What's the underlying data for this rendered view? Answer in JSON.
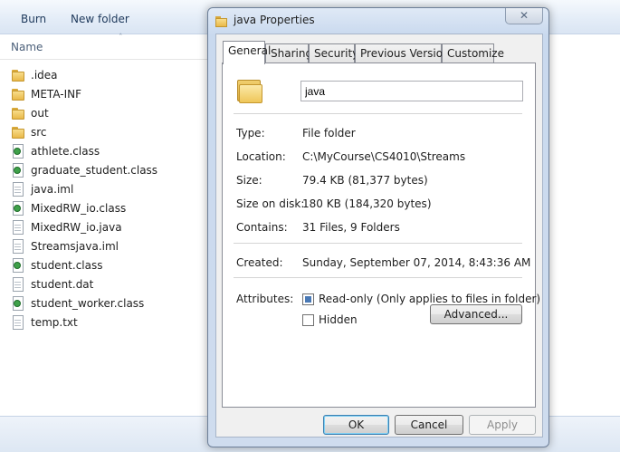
{
  "explorer": {
    "toolbar": {
      "burn_label": "Burn",
      "new_folder_label": "New folder"
    },
    "column_header": {
      "name_label": "Name",
      "sort_glyph": "ˆ"
    },
    "files": [
      {
        "name": ".idea",
        "icon": "folder-icon"
      },
      {
        "name": "META-INF",
        "icon": "folder-icon"
      },
      {
        "name": "out",
        "icon": "folder-icon"
      },
      {
        "name": "src",
        "icon": "folder-icon"
      },
      {
        "name": "athlete.class",
        "icon": "class-file-icon"
      },
      {
        "name": "graduate_student.class",
        "icon": "class-file-icon"
      },
      {
        "name": "java.iml",
        "icon": "file-icon"
      },
      {
        "name": "MixedRW_io.class",
        "icon": "class-file-icon"
      },
      {
        "name": "MixedRW_io.java",
        "icon": "file-icon"
      },
      {
        "name": "Streamsjava.iml",
        "icon": "file-icon"
      },
      {
        "name": "student.class",
        "icon": "class-file-icon"
      },
      {
        "name": "student.dat",
        "icon": "file-icon"
      },
      {
        "name": "student_worker.class",
        "icon": "class-file-icon"
      },
      {
        "name": "temp.txt",
        "icon": "file-icon"
      }
    ]
  },
  "dialog": {
    "title": "java Properties",
    "close_glyph": "✕",
    "tabs": [
      {
        "label": "General",
        "active": true
      },
      {
        "label": "Sharing",
        "active": false
      },
      {
        "label": "Security",
        "active": false
      },
      {
        "label": "Previous Versions",
        "active": false
      },
      {
        "label": "Customize",
        "active": false
      }
    ],
    "general": {
      "name_value": "java",
      "type_label": "Type:",
      "type_value": "File folder",
      "location_label": "Location:",
      "location_value": "C:\\MyCourse\\CS4010\\Streams",
      "size_label": "Size:",
      "size_value": "79.4 KB (81,377 bytes)",
      "size_on_disk_label": "Size on disk:",
      "size_on_disk_value": "180 KB (184,320 bytes)",
      "contains_label": "Contains:",
      "contains_value": "31 Files, 9 Folders",
      "created_label": "Created:",
      "created_value": "Sunday, September 07, 2014, 8:43:36 AM",
      "attributes_label": "Attributes:",
      "readonly_label": "Read-only (Only applies to files in folder)",
      "readonly_state": "indeterminate",
      "hidden_label": "Hidden",
      "hidden_checked": false,
      "advanced_label": "Advanced..."
    },
    "buttons": {
      "ok_label": "OK",
      "cancel_label": "Cancel",
      "apply_label": "Apply"
    }
  },
  "colors": {
    "accent": "#3c7fb1",
    "window_frame": "#c9d9ee",
    "check_fill": "#4a79b5"
  }
}
